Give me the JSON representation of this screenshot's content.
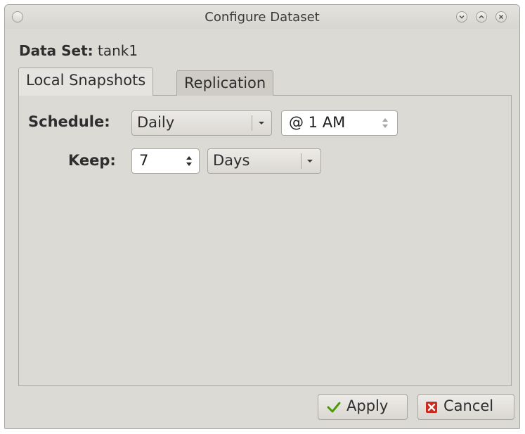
{
  "window": {
    "title": "Configure Dataset"
  },
  "dataset": {
    "label": "Data Set:",
    "value": "tank1"
  },
  "tabs": [
    {
      "label": "Local Snapshots",
      "active": true
    },
    {
      "label": "Replication",
      "active": false
    }
  ],
  "schedule": {
    "label": "Schedule:",
    "frequency": "Daily",
    "time": "@ 1 AM"
  },
  "keep": {
    "label": "Keep:",
    "count": "7",
    "unit": "Days"
  },
  "buttons": {
    "apply": "Apply",
    "cancel": "Cancel"
  },
  "icons": {
    "apply": "checkmark-icon",
    "cancel": "red-x-icon"
  },
  "colors": {
    "window_bg": "#dcdad5",
    "apply_check": "#4e9a06",
    "cancel_red": "#cc2a1f"
  }
}
